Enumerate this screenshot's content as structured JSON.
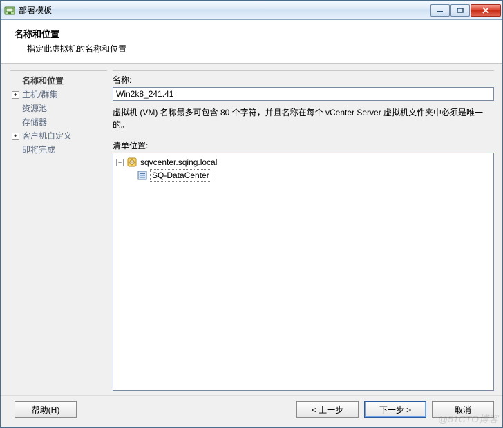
{
  "window": {
    "title": "部署模板"
  },
  "header": {
    "title": "名称和位置",
    "subtitle": "指定此虚拟机的名称和位置"
  },
  "sidebar": {
    "items": [
      {
        "label": "名称和位置",
        "bold": true,
        "expand": false
      },
      {
        "label": "主机/群集",
        "bold": false,
        "expand": true
      },
      {
        "label": "资源池",
        "bold": false,
        "expand": false
      },
      {
        "label": "存储器",
        "bold": false,
        "expand": false
      },
      {
        "label": "客户机自定义",
        "bold": false,
        "expand": true
      },
      {
        "label": "即将完成",
        "bold": false,
        "expand": false
      }
    ]
  },
  "form": {
    "name_label": "名称:",
    "name_value": "Win2k8_241.41",
    "hint": "虚拟机 (VM) 名称最多可包含 80 个字符，并且名称在每个 vCenter Server 虚拟机文件夹中必须是唯一的。",
    "inventory_label": "清单位置:"
  },
  "tree": {
    "root": {
      "label": "sqvcenter.sqing.local"
    },
    "child": {
      "label": "SQ-DataCenter",
      "selected": true
    }
  },
  "footer": {
    "help": "帮助(H)",
    "back": "< 上一步",
    "next": "下一步 >",
    "cancel": "取消"
  },
  "watermark": "@51CTO博客"
}
